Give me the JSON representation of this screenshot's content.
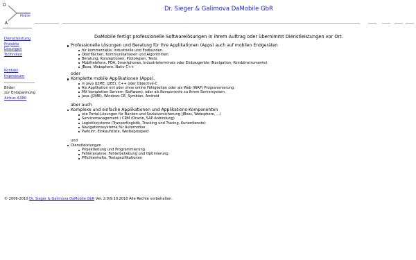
{
  "logo": {
    "letter_d": "D",
    "letter_a": "A",
    "brand": "Mobile"
  },
  "header": {
    "title": "Dr. Sieger & Galimova DaMobile GbR"
  },
  "sidebar": {
    "nav": [
      "Dienstleistung",
      "Projekte",
      "Lösungen",
      "Techniken"
    ],
    "contact": [
      "Kontakt",
      "Impressum"
    ],
    "pictures_label": [
      "Bilder",
      "zur Entspannung"
    ],
    "pictures_link": "Airbus A380"
  },
  "intro": "DaMobile fertigt professionelle Softwarelösungen in ihrem Auftrag oder übernimmt Dienstleistungen vor Ort.",
  "sections": [
    {
      "heading": "Professionelle Lösungen und Beratung für ihre Applikationen (Apps) auch auf mobilen Endgeräten",
      "items": [
        "für kommerzielle, industrielle und Endkunden.",
        "Oberflächen, Kommunikationen und Algorithmen.",
        "Beratung, Konzeptionen, Prototypen, Tests.",
        "Mobiltelefone, PDA, Smartphones, Industrieterminals oder Einbaugeräte (Navigation, Kombiinstrumente).",
        "JBoss, Websphere, Nativ C++"
      ]
    },
    {
      "connector": "oder",
      "heading": "Komplette mobile Applikationen (Apps).",
      "items": [
        "in Java (J2ME, J2EE), C++ oder Objective-C",
        "Als Applikation mit oder ohne online Fähigkeiten oder als Web (WAP) Programmierung.",
        "Mit kompletten Servern (Software), oder als Komponente zu Ihrem Serversystem.",
        "Java (J2ME), Windows CE, Symbian, Android"
      ]
    },
    {
      "connector": "aber auch",
      "heading": "Komplexe und einfache Applikationen und Applikations-Komponenten",
      "items": [
        "wie Portal-Lösungen für Banken und Sozialversicherung (JBoss, Websphere, ...)",
        "Servicemanagement / CRM (Oracle, SAP Anbindung)",
        "Logistiksysteme (Tranportlogistik, Tracking und Tracing, Kurierdienste)",
        "Navigationssysteme für Automotive",
        "Parkuhr, Einkaufsliste, Werbeprospekt"
      ]
    },
    {
      "connector": "und",
      "heading": "Dienstleistungen",
      "items": [
        "Projektleitung und Programmierung",
        "Fehleranalyse, Fehlerbehebung und Optimierung",
        "Pflichtenhefte, Testspezifikationen"
      ]
    }
  ],
  "footer": {
    "prefix": "© 2006-2010",
    "link": "Dr. Sieger & Galimova DaMobile GbR",
    "suffix": "Ver. 2.0/9.10.2010 Alle Rechte vorbehalten."
  }
}
